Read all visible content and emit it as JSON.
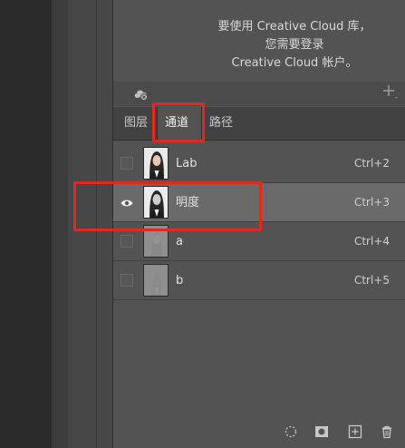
{
  "cc": {
    "line1": "要使用 Creative Cloud 库，您需要登录",
    "line2": "Creative Cloud 帐户。"
  },
  "tabs": [
    {
      "label": "图层",
      "active": false
    },
    {
      "label": "通道",
      "active": true
    },
    {
      "label": "路径",
      "active": false
    }
  ],
  "channels": [
    {
      "name": "Lab",
      "shortcut": "Ctrl+2",
      "visible": false,
      "selected": false,
      "thumb": "color"
    },
    {
      "name": "明度",
      "shortcut": "Ctrl+3",
      "visible": true,
      "selected": true,
      "thumb": "gray"
    },
    {
      "name": "a",
      "shortcut": "Ctrl+4",
      "visible": false,
      "selected": false,
      "thumb": "flat"
    },
    {
      "name": "b",
      "shortcut": "Ctrl+5",
      "visible": false,
      "selected": false,
      "thumb": "flat"
    }
  ],
  "icons": {
    "cloud": "cloud-offline-icon",
    "add": "plus-icon",
    "bottom": [
      "selection-icon",
      "mask-icon",
      "new-channel-icon",
      "trash-icon"
    ]
  },
  "colors": {
    "highlight": "#e02a20"
  }
}
